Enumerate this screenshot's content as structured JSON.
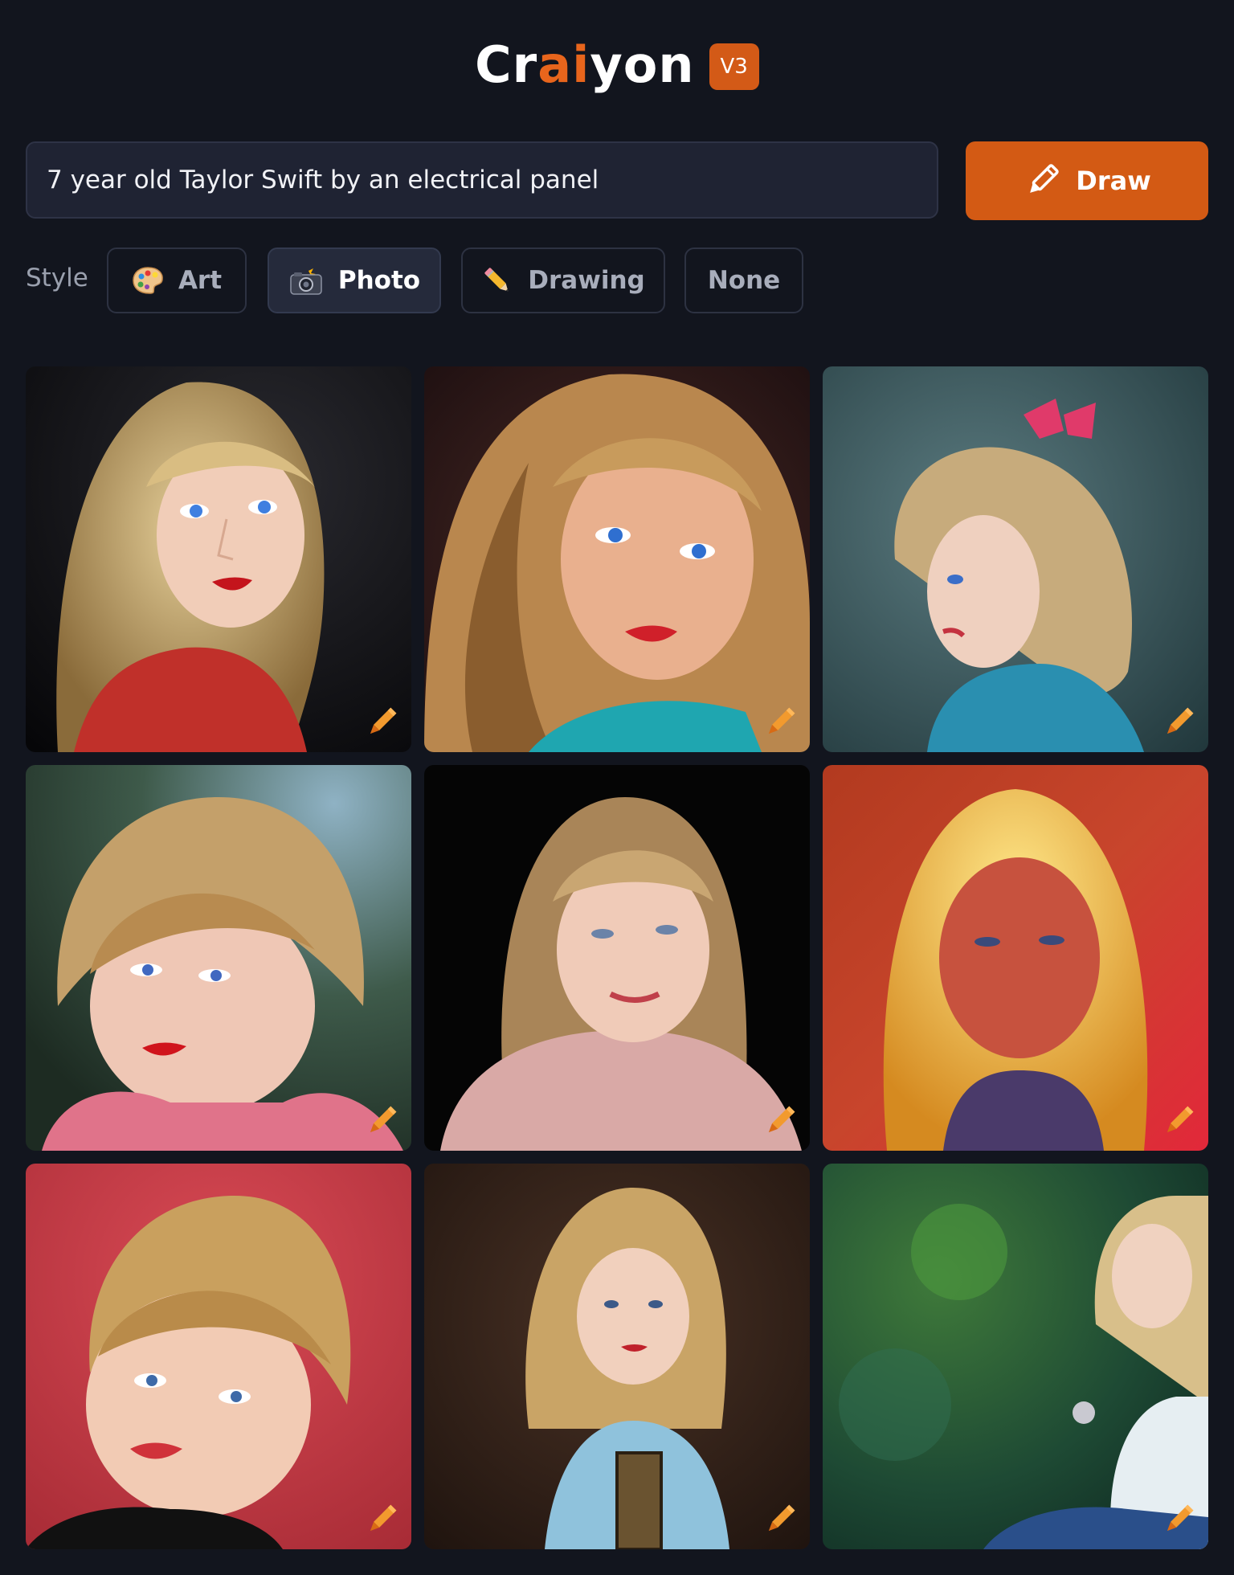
{
  "logo": {
    "part1": "Cr",
    "part2": "ai",
    "part3": "yon",
    "badge": "V3"
  },
  "prompt": {
    "value": "7 year old Taylor Swift by an electrical panel"
  },
  "draw_button": {
    "label": "Draw",
    "icon": "pencil-icon"
  },
  "style": {
    "label": "Style",
    "options": [
      {
        "label": "Art",
        "icon": "palette-icon",
        "selected": false
      },
      {
        "label": "Photo",
        "icon": "camera-flash-icon",
        "selected": true
      },
      {
        "label": "Drawing",
        "icon": "pencil-icon",
        "selected": false
      },
      {
        "label": "None",
        "icon": "",
        "selected": false
      }
    ]
  },
  "colors": {
    "background": "#12151e",
    "accent": "#d35a14",
    "input_bg": "#1f2333"
  },
  "results": {
    "count": 9,
    "tile_icon": "edit-pencil-icon"
  }
}
